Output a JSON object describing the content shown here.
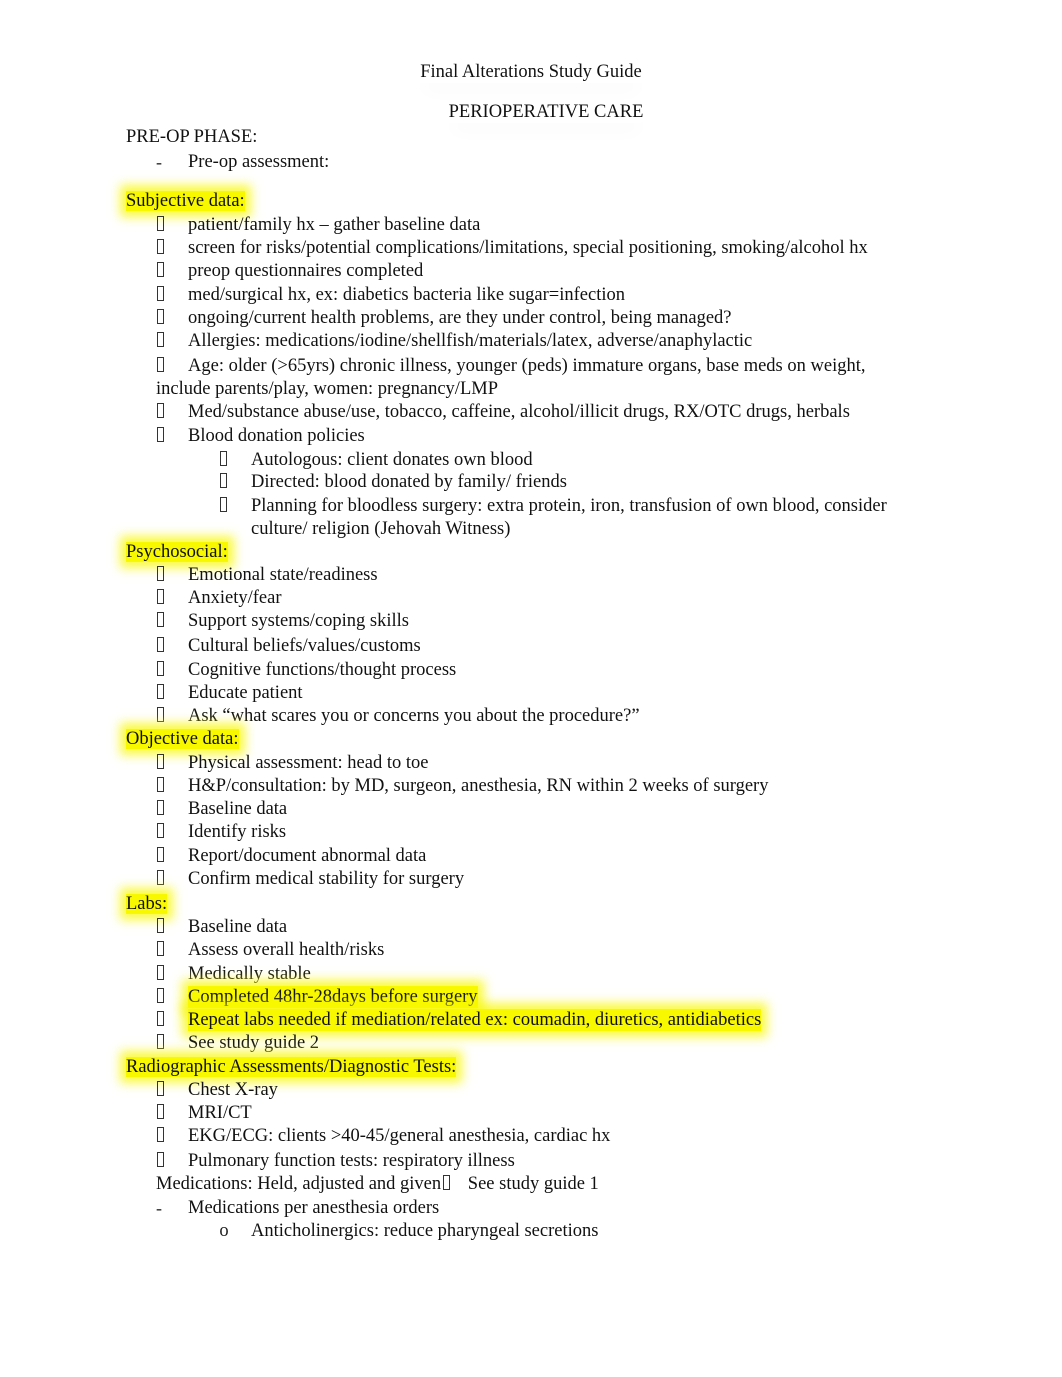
{
  "document": {
    "title": "Final Alterations Study Guide",
    "subtitle": "PERIOPERATIVE CARE",
    "phase_heading": "PRE-OP PHASE:",
    "preop_item": "Pre-op assessment:",
    "bullet_icon": "box-bullet",
    "dash_marker": "-",
    "o_marker": "o",
    "highlight_color": "#f8f800"
  },
  "subjective": {
    "heading": "Subjective data:",
    "items": [
      "patient/family hx – gather baseline data",
      "screen for risks/potential complications/limitations, special positioning, smoking/alcohol hx",
      "preop questionnaires completed",
      "med/surgical hx, ex: diabetics bacteria like sugar=infection",
      "ongoing/current health problems, are they under control, being managed?",
      "Allergies: medications/iodine/shellfish/materials/latex, adverse/anaphylactic"
    ],
    "age_line1": "Age: older (>65yrs) chronic illness, younger (peds) immature organs, base meds on weight,",
    "age_line2": "include parents/play, women: pregnancy/LMP",
    "items2": [
      "Med/substance abuse/use, tobacco, caffeine, alcohol/illicit drugs, RX/OTC drugs, herbals",
      "Blood donation policies"
    ],
    "blood_items": [
      "Autologous: client donates own blood",
      "Directed: blood donated by family/ friends"
    ],
    "bloodless_line1": "Planning for bloodless surgery: extra protein, iron, transfusion of own blood, consider",
    "bloodless_line2": "culture/ religion (Jehovah Witness)"
  },
  "psychosocial": {
    "heading": "Psychosocial:",
    "items": [
      "Emotional state/readiness",
      "Anxiety/fear",
      "Support systems/coping skills",
      "Cultural beliefs/values/customs",
      "Cognitive functions/thought process",
      "Educate patient",
      "Ask “what scares you or concerns you about the procedure?”"
    ]
  },
  "objective": {
    "heading": "Objective data:",
    "items": [
      "Physical assessment: head to toe",
      "H&P/consultation: by MD, surgeon, anesthesia, RN within 2 weeks of surgery",
      "Baseline data",
      "Identify risks",
      "Report/document abnormal data",
      "Confirm medical stability for surgery"
    ]
  },
  "labs": {
    "heading": "Labs:",
    "items": [
      "Baseline data",
      "Assess overall health/risks",
      "Medically stable"
    ],
    "highlighted_items": [
      "Completed 48hr-28days before surgery",
      "Repeat labs needed if mediation/related ex: coumadin, diuretics, antidiabetics"
    ],
    "last_item": "See study guide 2"
  },
  "radiographic": {
    "heading": "Radiographic Assessments/Diagnostic Tests:",
    "items": [
      "Chest X-ray",
      "MRI/CT",
      "EKG/ECG: clients >40-45/general anesthesia, cardiac hx",
      "Pulmonary function tests: respiratory illness"
    ]
  },
  "medications": {
    "line_prefix": "Medications:  Held, adjusted and given",
    "line_suffix": "See study guide 1",
    "dash_item": "Medications per anesthesia orders",
    "sub_item": "Anticholinergics: reduce pharyngeal secretions"
  }
}
